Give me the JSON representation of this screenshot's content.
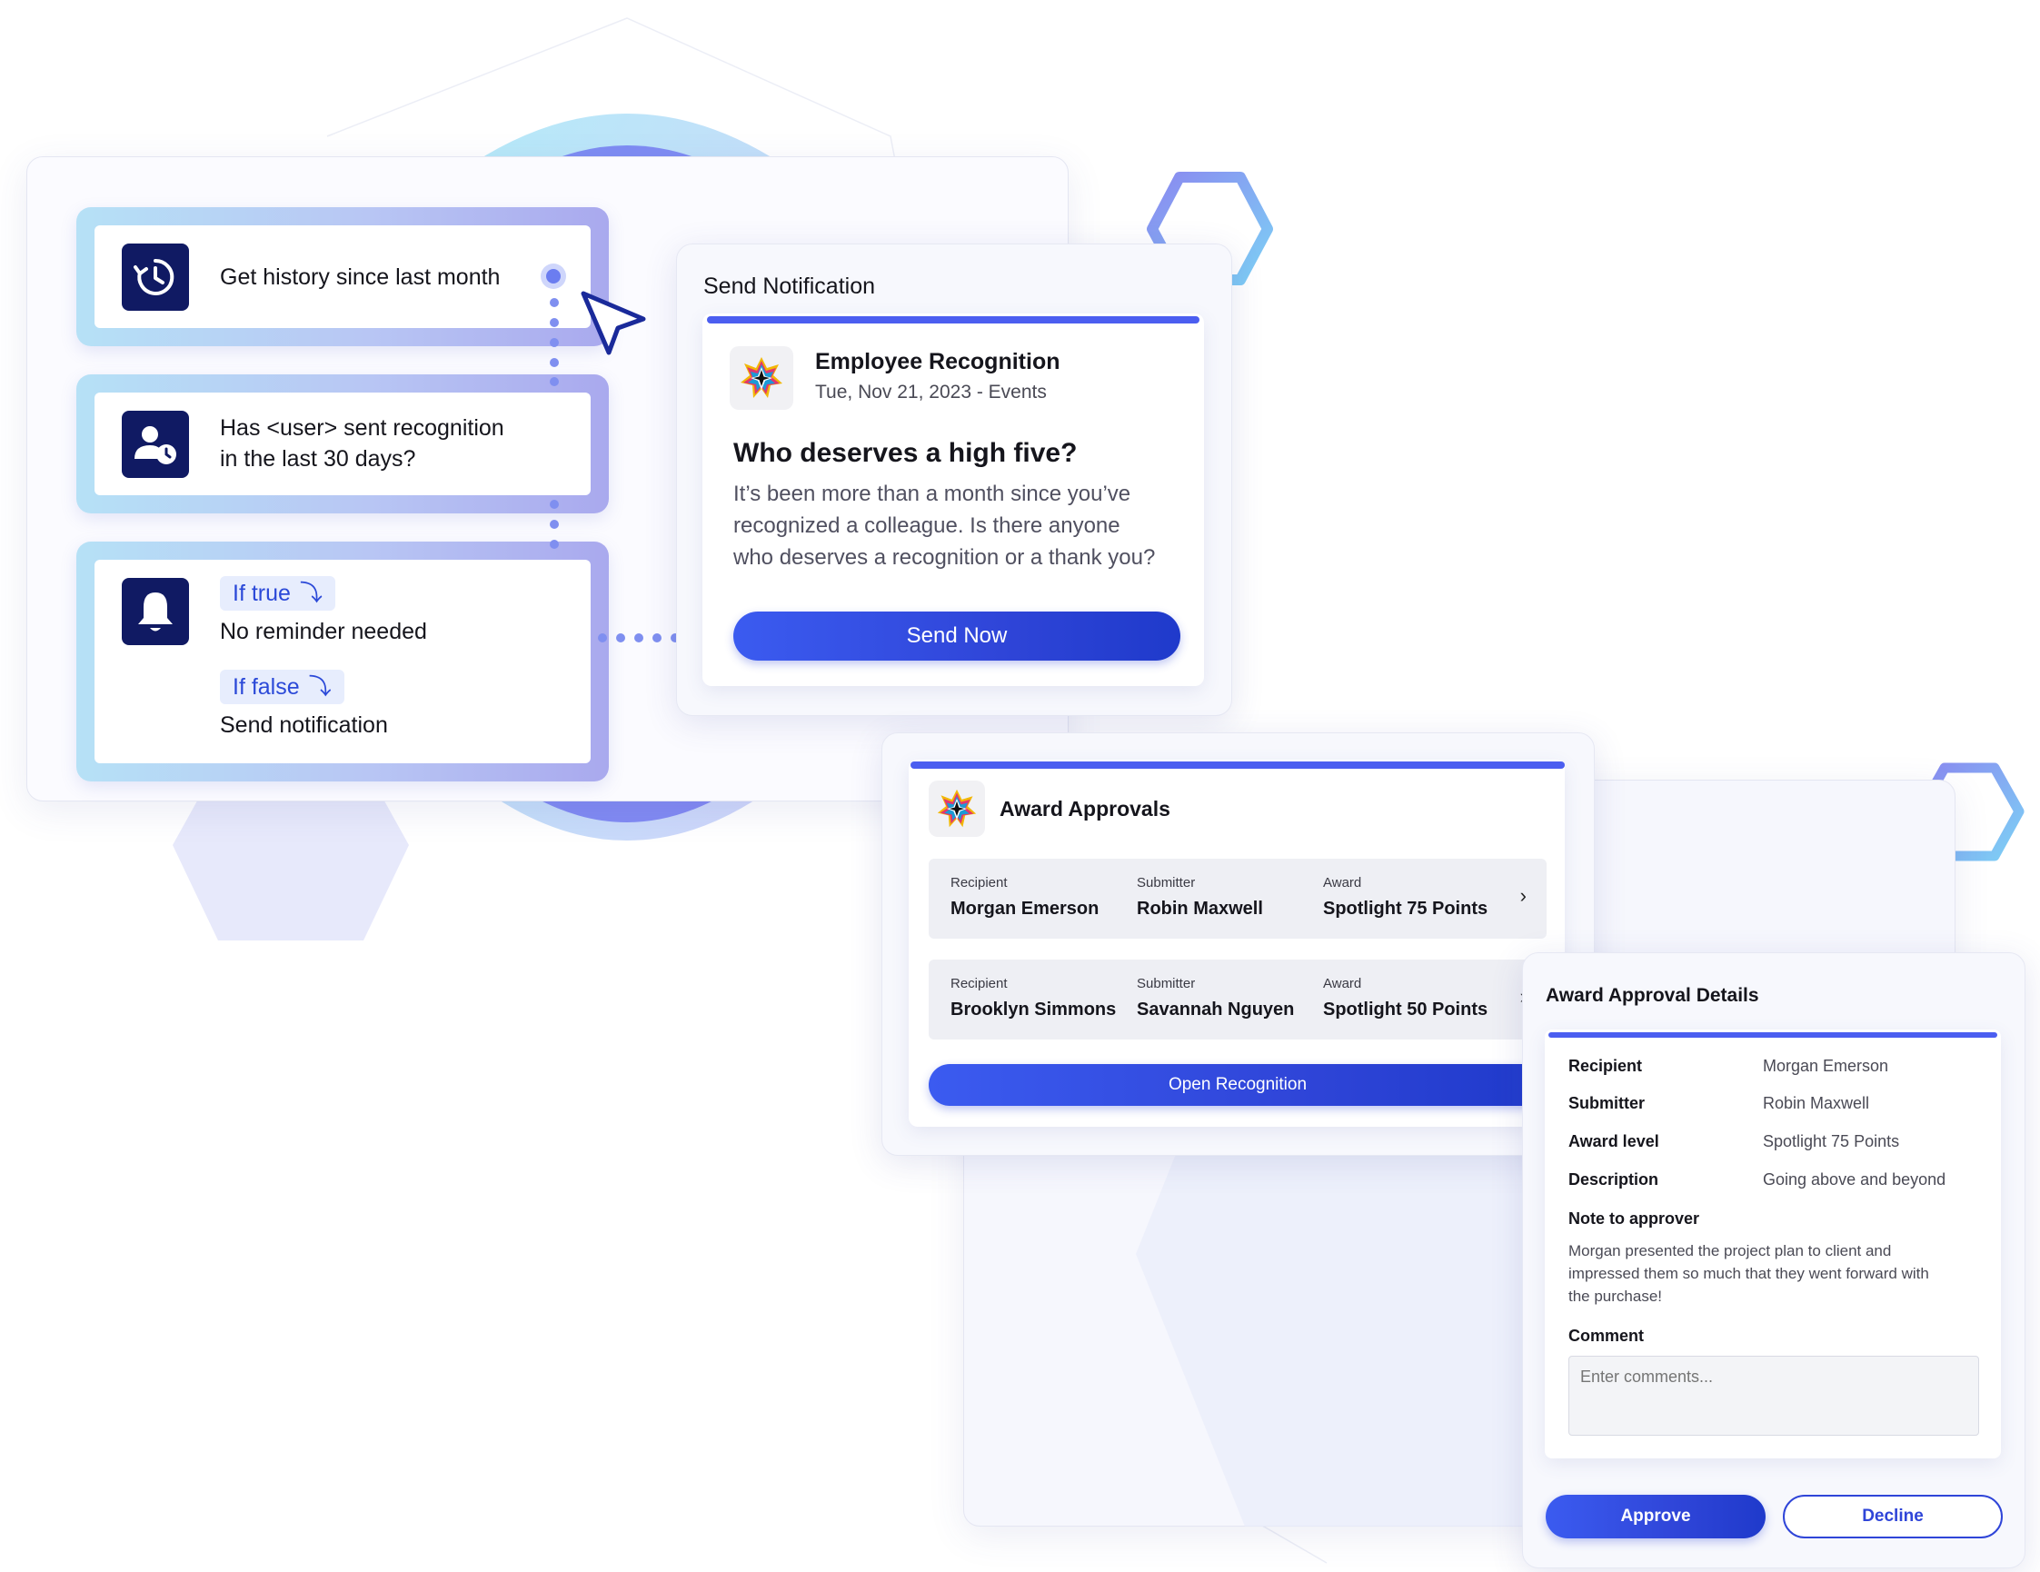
{
  "workflow": {
    "step1_text": "Get history since last month",
    "step2_line1": "Has <user> sent recognition",
    "step2_line2": "in the last 30 days?",
    "step3_true_label": "If true",
    "step3_true_text": "No reminder needed",
    "step3_false_label": "If false",
    "step3_false_text": "Send notification",
    "icons": [
      "history-icon",
      "user-clock-icon",
      "bell-icon",
      "return-arrow-icon"
    ]
  },
  "notification": {
    "panel_title": "Send Notification",
    "app_name": "Employee Recognition",
    "meta": "Tue, Nov 21, 2023 - Events",
    "headline": "Who deserves a high five?",
    "body_line1": "It’s been more than a month since you’ve",
    "body_line2": "recognized a colleague. Is there anyone",
    "body_line3": "who deserves a recognition or a thank you?",
    "button_label": "Send Now"
  },
  "approvals": {
    "title": "Award Approvals",
    "columns": [
      "Recipient",
      "Submitter",
      "Award"
    ],
    "rows": [
      {
        "recipient": "Morgan Emerson",
        "submitter": "Robin Maxwell",
        "award": "Spotlight 75 Points"
      },
      {
        "recipient": "Brooklyn Simmons",
        "submitter": "Savannah Nguyen",
        "award": "Spotlight 50 Points"
      }
    ],
    "button_label": "Open Recognition"
  },
  "details": {
    "title": "Award Approval Details",
    "recipient_label": "Recipient",
    "recipient_value": "Morgan Emerson",
    "submitter_label": "Submitter",
    "submitter_value": "Robin Maxwell",
    "award_label": "Award level",
    "award_value": "Spotlight 75 Points",
    "description_label": "Description",
    "description_value": "Going above and beyond",
    "note_label": "Note to approver",
    "note_line1": "Morgan presented the project plan to client and",
    "note_line2": "impressed them so much that they went forward with",
    "note_line3": "the purchase!",
    "comment_label": "Comment",
    "comment_placeholder": "Enter comments...",
    "approve_label": "Approve",
    "decline_label": "Decline"
  },
  "colors": {
    "accent": "#3b5bf0",
    "dark_navy": "#101a63",
    "pill_bg": "#e7edfd",
    "pill_text": "#2b49d8"
  }
}
